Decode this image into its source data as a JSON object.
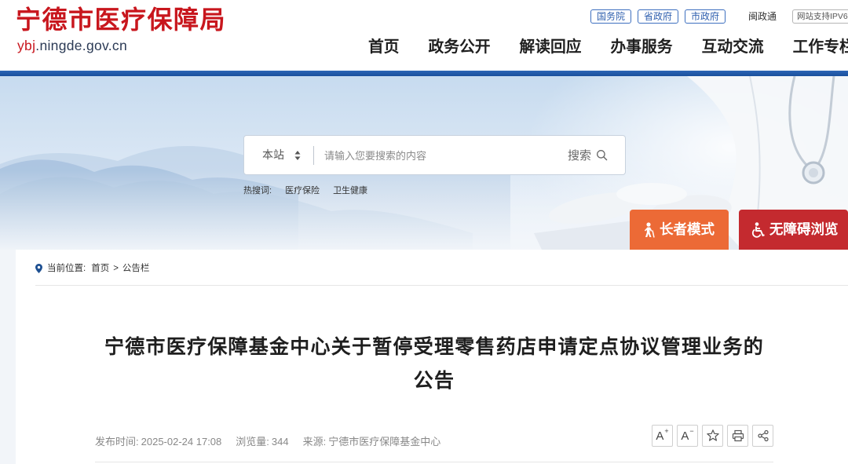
{
  "site": {
    "title": "宁德市医疗保障局",
    "domain_prefix": "ybj",
    "domain_suffix": ".ningde.gov.cn"
  },
  "top_links": {
    "gov_links": [
      "国务院",
      "省政府",
      "市政府"
    ],
    "minzhengtong": "闽政通",
    "ipv6_badge": "网站支持IPV6"
  },
  "nav": [
    "首页",
    "政务公开",
    "解读回应",
    "办事服务",
    "互动交流",
    "工作专栏"
  ],
  "search": {
    "scope": "本站",
    "scope_icon": "sort-arrows-icon",
    "placeholder": "请输入您要搜索的内容",
    "button": "搜索",
    "button_icon": "search-icon"
  },
  "hot_search": {
    "label": "热搜词:",
    "words": [
      "医疗保险",
      "卫生健康"
    ]
  },
  "accessibility": {
    "elder_mode": {
      "label": "长者模式",
      "icon": "elderly-person-icon",
      "color": "#ec6a36"
    },
    "barrier_free": {
      "label": "无障碍浏览",
      "icon": "wheelchair-icon",
      "color": "#c42a2f"
    }
  },
  "breadcrumb": {
    "icon": "location-pin-icon",
    "label": "当前位置:",
    "items": [
      "首页",
      "公告栏"
    ],
    "separator": ">"
  },
  "article": {
    "title": "宁德市医疗保障基金中心关于暂停受理零售药店申请定点协议管理业务的公告",
    "published_label": "发布时间:",
    "published_value": "2025-02-24 17:08",
    "views_label": "浏览量:",
    "views_value": "344",
    "source_label": "来源:",
    "source_value": "宁德市医疗保障基金中心"
  },
  "tools": [
    {
      "icon": "font-increase-icon",
      "glyph": "A",
      "mark": "+"
    },
    {
      "icon": "font-decrease-icon",
      "glyph": "A",
      "mark": "−"
    },
    {
      "icon": "star-icon"
    },
    {
      "icon": "print-icon"
    },
    {
      "icon": "share-icon"
    }
  ],
  "colors": {
    "brand_red": "#c8161d",
    "header_bar_blue": "#1f5bab",
    "gov_link_blue": "#2e5fae",
    "title_text": "#1e1e1e",
    "meta_text": "#888888"
  }
}
